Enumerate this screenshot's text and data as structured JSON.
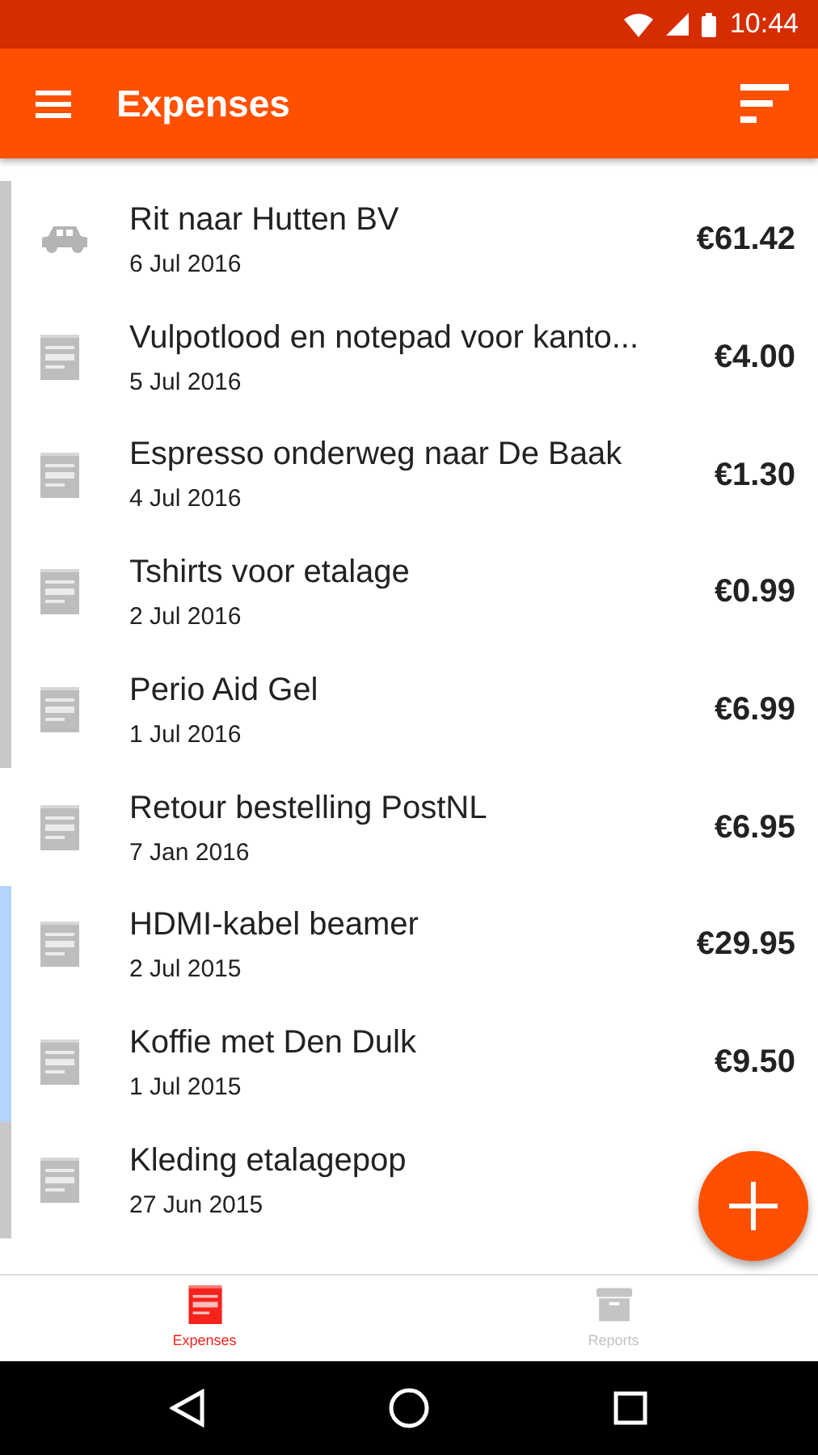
{
  "status_bar": {
    "time": "10:44"
  },
  "app_bar": {
    "title": "Expenses"
  },
  "expenses": [
    {
      "kind": "car",
      "title": "Rit naar Hutten BV",
      "date": "6 Jul 2016",
      "amount": "€61.42",
      "color": "#c8c8c8"
    },
    {
      "kind": "receipt",
      "title": "Vulpotlood en notepad voor kanto...",
      "date": "5 Jul 2016",
      "amount": "€4.00",
      "color": "#c8c8c8"
    },
    {
      "kind": "receipt",
      "title": "Espresso onderweg naar De Baak",
      "date": "4 Jul 2016",
      "amount": "€1.30",
      "color": "#c8c8c8"
    },
    {
      "kind": "receipt",
      "title": "Tshirts voor etalage",
      "date": "2 Jul 2016",
      "amount": "€0.99",
      "color": "#c8c8c8"
    },
    {
      "kind": "receipt",
      "title": "Perio Aid Gel",
      "date": "1 Jul 2016",
      "amount": "€6.99",
      "color": "#c8c8c8"
    },
    {
      "kind": "receipt",
      "title": "Retour bestelling PostNL",
      "date": "7 Jan 2016",
      "amount": "€6.95"
    },
    {
      "kind": "receipt",
      "title": "HDMI-kabel beamer",
      "date": "2 Jul 2015",
      "amount": "€29.95",
      "color": "#b3d4fc"
    },
    {
      "kind": "receipt",
      "title": "Koffie met Den Dulk",
      "date": "1 Jul 2015",
      "amount": "€9.50",
      "color": "#b3d4fc"
    },
    {
      "kind": "receipt",
      "title": "Kleding etalagepop",
      "date": "27 Jun 2015",
      "color": "#c8c8c8"
    }
  ],
  "bottom_nav": [
    {
      "kind": "receipt",
      "label": "Expenses",
      "selected": true
    },
    {
      "kind": "archive",
      "label": "Reports",
      "selected": false
    }
  ]
}
